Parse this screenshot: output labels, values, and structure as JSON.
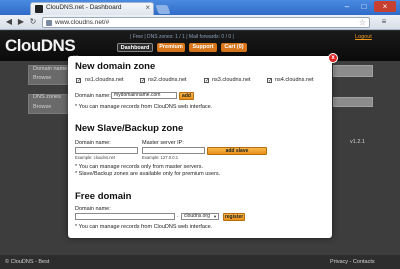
{
  "browser": {
    "tab_title": "ClouDNS.net - Dashboard",
    "tab_close": "×",
    "url": "www.cloudns.net/#",
    "icons": {
      "back": "back-arrow-icon",
      "forward": "forward-arrow-icon",
      "reload": "reload-icon",
      "star": "star-icon",
      "menu": "wrench-icon"
    },
    "glyphs": {
      "back": "◀",
      "forward": "▶",
      "reload": "↻",
      "star": "☆",
      "menu": "≡",
      "minimize": "–",
      "maximize": "□",
      "close": "×"
    }
  },
  "header": {
    "logo": "ClouDNS",
    "logo_sub": ".net",
    "info": "| Free | DNS zones: 1 / 1 | Mail forwards: 0 / 0 |",
    "logout": "Logout",
    "nav": {
      "dashboard": "Dashboard",
      "premium": "Premium",
      "support": "Support",
      "cart": "Cart (0)"
    }
  },
  "background": {
    "domain_name_label": "Domain name",
    "browse_label": "Browse",
    "dns_zones_label": "DNS zones",
    "browse2_label": "Browse",
    "version": "v1.2.1",
    "footer_left": "© ClouDNS - Best",
    "footer_right": "Privacy - Contacts"
  },
  "modal": {
    "close_glyph": "x",
    "new_zone": {
      "title": "New domain zone",
      "nameservers": [
        {
          "label": "ns1.cloudns.net",
          "checked": "✓"
        },
        {
          "label": "ns2.cloudns.net",
          "checked": "✓"
        },
        {
          "label": "ns3.cloudns.net",
          "checked": "✓"
        },
        {
          "label": "ns4.cloudns.net",
          "checked": "✓"
        }
      ],
      "domain_label": "Domain name:",
      "domain_value": "mydomainname.com",
      "add_button": "add",
      "note": "* You can manage records from ClouDNS web interface."
    },
    "slave_zone": {
      "title": "New Slave/Backup zone",
      "domain_label": "Domain name:",
      "master_label": "Master server IP:",
      "domain_example": "Example: cloudns.net",
      "master_example": "Example: 127.0.0.1",
      "add_button": "add slave",
      "note1": "* You can manage records only from master servers.",
      "note2": "* Slave/Backup zones are available only for premium users."
    },
    "free_domain": {
      "title": "Free domain",
      "domain_label": "Domain name:",
      "dot": ".",
      "tld_selected": "cloudns.org",
      "register_button": "register",
      "note": "* You can manage records from ClouDNS web interface."
    }
  }
}
